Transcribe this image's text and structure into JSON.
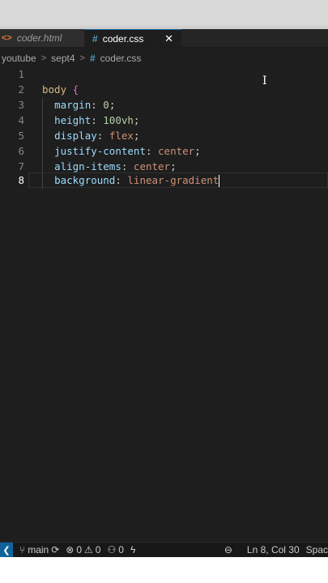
{
  "tabs": [
    {
      "label": "coder.html",
      "icon": "html-file-icon"
    },
    {
      "label": "coder.css",
      "icon": "css-file-icon"
    }
  ],
  "breadcrumb": [
    "youtube",
    "sept4",
    "coder.css"
  ],
  "editor": {
    "line_numbers": [
      "1",
      "2",
      "3",
      "4",
      "5",
      "6",
      "7",
      "8"
    ],
    "current_line": "8",
    "lines": {
      "l2": {
        "selector": "body",
        "brace": "{"
      },
      "l3": {
        "prop": "margin",
        "value": "0"
      },
      "l4": {
        "prop": "height",
        "value": "100vh"
      },
      "l5": {
        "prop": "display",
        "value": "flex"
      },
      "l6": {
        "prop": "justify-content",
        "value": "center"
      },
      "l7": {
        "prop": "align-items",
        "value": "center"
      },
      "l8": {
        "prop": "background",
        "value": "linear-gradient"
      }
    }
  },
  "statusbar": {
    "branch": "main",
    "errors": "0",
    "warnings": "0",
    "ports": "0",
    "position": "Ln 8, Col 30",
    "spaces": "Spac"
  },
  "colors": {
    "editor_bg": "#1e1e1e",
    "accent": "#0e639c"
  }
}
